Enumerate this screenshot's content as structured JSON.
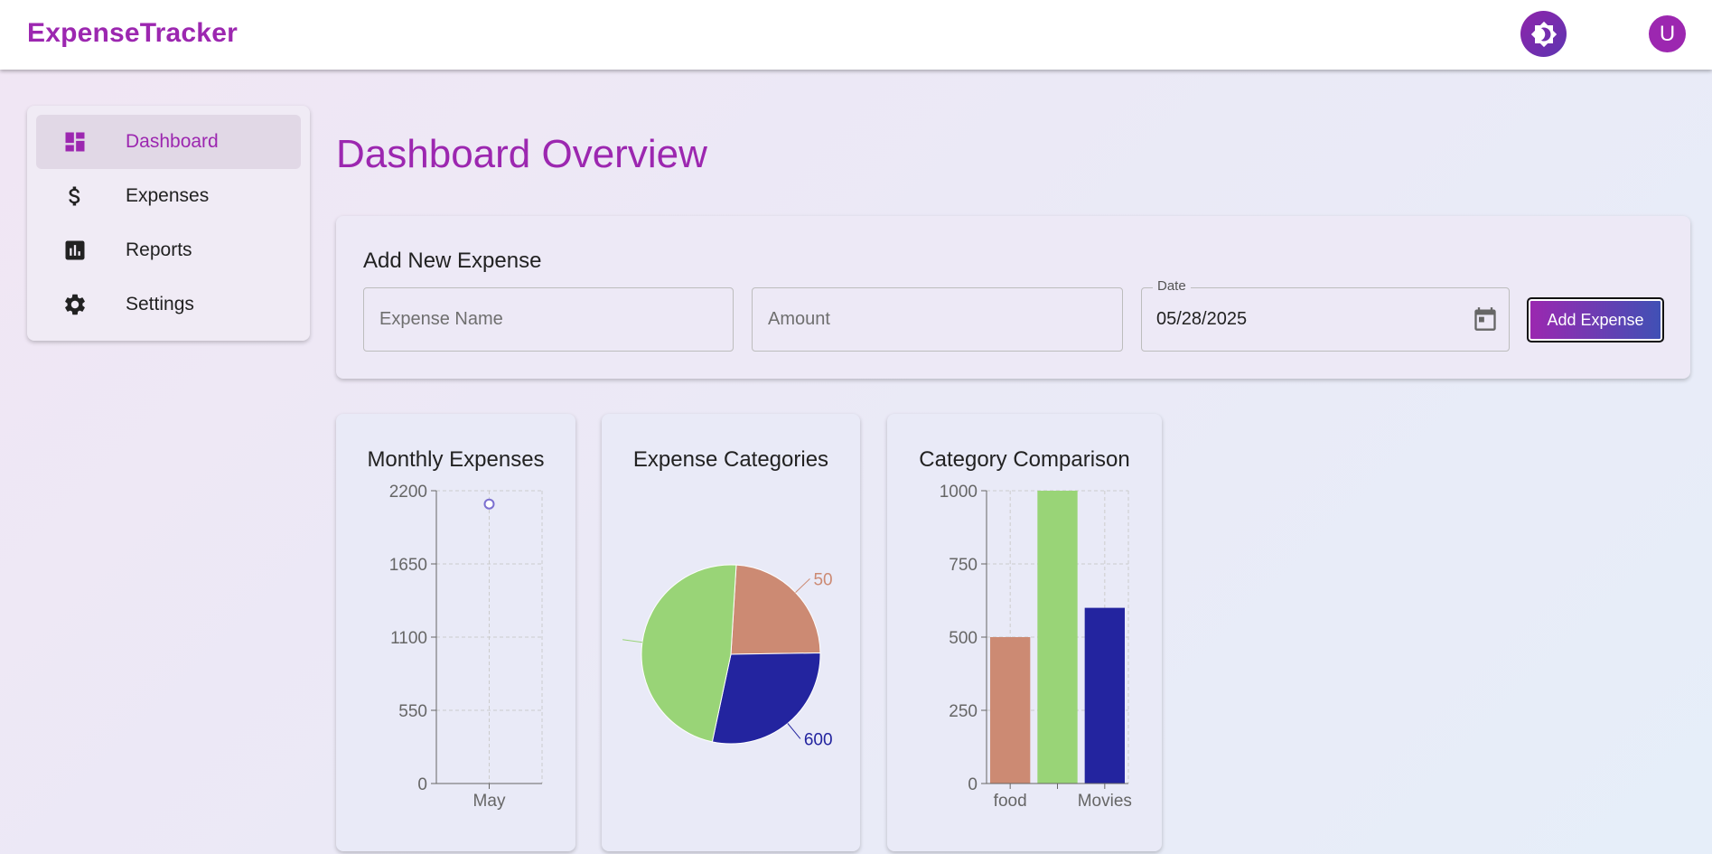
{
  "app": {
    "title": "ExpenseTracker",
    "avatar_initial": "U"
  },
  "header": {
    "theme_toggle_icon": "brightness-icon",
    "avatar_icon": "avatar"
  },
  "sidebar": {
    "items": [
      {
        "label": "Dashboard",
        "icon": "dashboard-icon",
        "active": true
      },
      {
        "label": "Expenses",
        "icon": "dollar-icon",
        "active": false
      },
      {
        "label": "Reports",
        "icon": "bar-chart-icon",
        "active": false
      },
      {
        "label": "Settings",
        "icon": "gear-icon",
        "active": false
      }
    ]
  },
  "main": {
    "title": "Dashboard Overview"
  },
  "form": {
    "title": "Add New Expense",
    "name_placeholder": "Expense Name",
    "amount_placeholder": "Amount",
    "date_label": "Date",
    "date_value": "05/28/2025",
    "submit_label": "Add Expense"
  },
  "colors": {
    "brand": "#9c27b0",
    "food": "#cc8a73",
    "green": "#99d477",
    "movies": "#23249f",
    "line": "#7b6fd0"
  },
  "chart_data": [
    {
      "type": "line",
      "title": "Monthly Expenses",
      "categories": [
        "May"
      ],
      "series": [
        {
          "values": [
            2100
          ]
        }
      ],
      "yticks": [
        "0",
        "550",
        "1100",
        "1650",
        "2200"
      ],
      "ylim": [
        0,
        2200
      ],
      "grid": true
    },
    {
      "type": "pie",
      "title": "Expense Categories",
      "slices": [
        {
          "value": 500,
          "color": "#cc8a73",
          "label": "50"
        },
        {
          "value": 600,
          "color": "#23249f",
          "label": "600"
        },
        {
          "value": 1000,
          "color": "#99d477",
          "label": ""
        }
      ]
    },
    {
      "type": "bar",
      "title": "Category Comparison",
      "categories": [
        "food",
        "",
        "Movies"
      ],
      "xtick_labels": [
        "food",
        "Movies"
      ],
      "values": [
        500,
        1000,
        600
      ],
      "colors": [
        "#cc8a73",
        "#99d477",
        "#23249f"
      ],
      "yticks": [
        "0",
        "250",
        "500",
        "750",
        "1000"
      ],
      "ylim": [
        0,
        1000
      ],
      "grid": true
    }
  ]
}
